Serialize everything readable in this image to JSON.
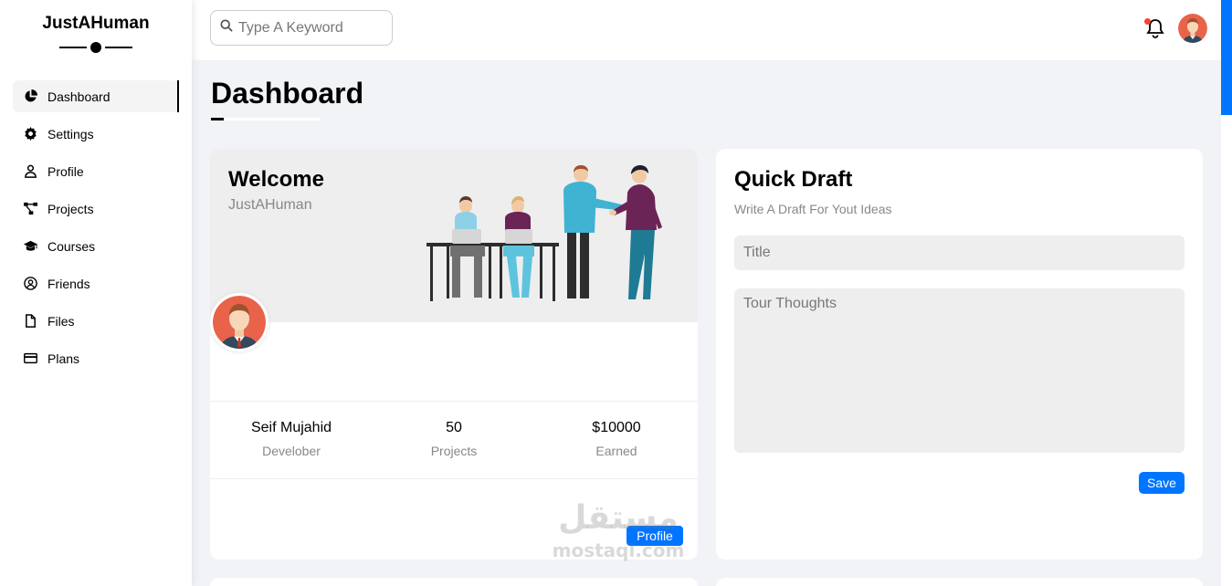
{
  "brand": {
    "title": "JustAHuman"
  },
  "sidebar": {
    "items": [
      {
        "label": "Dashboard",
        "icon": "chart-pie-icon",
        "active": true
      },
      {
        "label": "Settings",
        "icon": "gear-icon",
        "active": false
      },
      {
        "label": "Profile",
        "icon": "user-icon",
        "active": false
      },
      {
        "label": "Projects",
        "icon": "diagram-project-icon",
        "active": false
      },
      {
        "label": "Courses",
        "icon": "graduation-cap-icon",
        "active": false
      },
      {
        "label": "Friends",
        "icon": "user-circle-icon",
        "active": false
      },
      {
        "label": "Files",
        "icon": "file-icon",
        "active": false
      },
      {
        "label": "Plans",
        "icon": "credit-card-icon",
        "active": false
      }
    ]
  },
  "header": {
    "search_placeholder": "Type A Keyword",
    "has_notification": true
  },
  "page": {
    "title": "Dashboard"
  },
  "welcome": {
    "heading": "Welcome",
    "subtitle": "JustAHuman",
    "stats": [
      {
        "value": "Seif Mujahid",
        "label": "Develober"
      },
      {
        "value": "50",
        "label": "Projects"
      },
      {
        "value": "$10000",
        "label": "Earned"
      }
    ],
    "profile_button": "Profile"
  },
  "draft": {
    "heading": "Quick Draft",
    "subtitle": "Write A Draft For Yout Ideas",
    "title_placeholder": "Title",
    "text_placeholder": "Tour Thoughts",
    "save_button": "Save"
  },
  "watermark": {
    "arabic": "مستقل",
    "latin": "mostaql.com"
  },
  "colors": {
    "accent": "#0075ff",
    "notification": "#f44336",
    "background": "#f1f3f7",
    "card_muted": "#eeeeee"
  }
}
